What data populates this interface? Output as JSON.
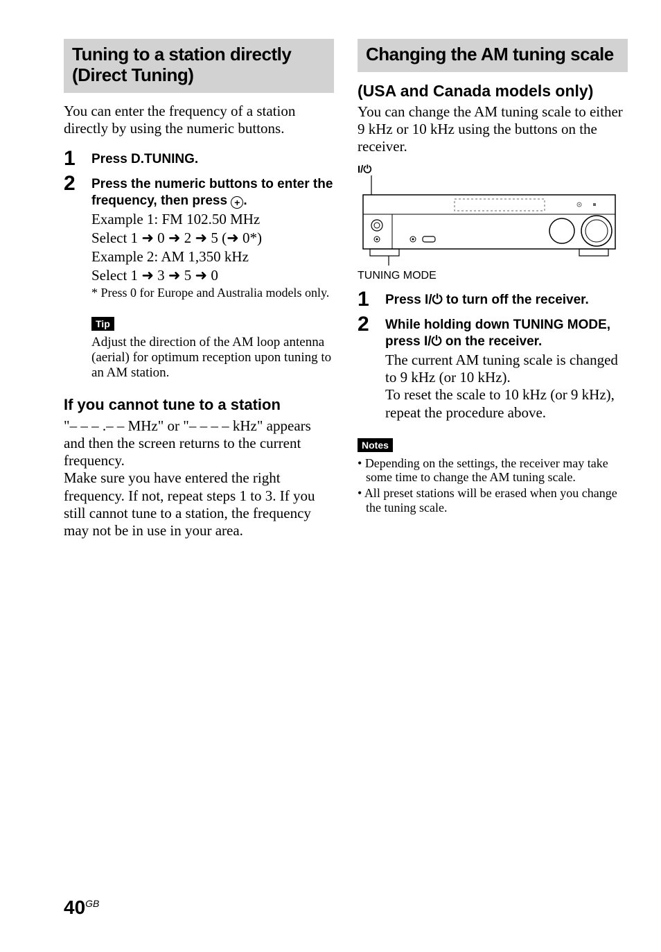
{
  "left": {
    "header": "Tuning to a station directly (Direct Tuning)",
    "intro": "You can enter the frequency of a station directly by using the numeric buttons.",
    "steps": [
      {
        "num": "1",
        "bold": "Press D.TUNING."
      },
      {
        "num": "2",
        "bold_pre": "Press the numeric buttons to enter the frequency, then press ",
        "bold_post": ".",
        "enter_icon": "+",
        "ex1": "Example 1: FM 102.50 MHz",
        "sel1_pre": "Select 1 ",
        "sel1_mid": " 0 ",
        "sel1_mid2": " 2 ",
        "sel1_mid3": " 5 (",
        "sel1_end": " 0*)",
        "ex2": "Example 2: AM 1,350 kHz",
        "sel2_pre": "Select 1 ",
        "sel2_mid": " 3 ",
        "sel2_mid2": " 5 ",
        "sel2_end": " 0",
        "footnote": "* Press 0 for Europe and Australia models only."
      }
    ],
    "tip_label": "Tip",
    "tip_body": "Adjust the direction of the AM loop antenna (aerial) for optimum reception upon tuning to an AM station.",
    "sub_heading": "If you cannot tune to a station",
    "sub_body": "\"– – – .– – MHz\" or \"– – – – kHz\" appears and then the screen returns to the current frequency.\nMake sure you have entered the right frequency. If not, repeat steps 1 to 3. If you still cannot tune to a station, the frequency may not be in use in your area."
  },
  "right": {
    "header": "Changing the AM tuning scale",
    "usa_heading": "(USA and Canada models only)",
    "intro": "You can change the AM tuning scale to either 9 kHz or 10 kHz using the buttons on the receiver.",
    "label_top_pre": "I/",
    "power_icon": "⏻",
    "label_bottom": "TUNING MODE",
    "steps": [
      {
        "num": "1",
        "bold_pre": "Press I/",
        "bold_post": " to turn off the receiver."
      },
      {
        "num": "2",
        "bold_pre": "While holding down TUNING MODE, press I/",
        "bold_post": " on the receiver.",
        "body": "The current AM tuning scale is changed to 9 kHz (or 10 kHz).\nTo reset the scale to 10 kHz (or 9 kHz), repeat the procedure above."
      }
    ],
    "notes_label": "Notes",
    "notes": [
      "Depending on the settings, the receiver may take some time to change the AM tuning scale.",
      "All preset stations will be erased when you change the tuning scale."
    ]
  },
  "page_number": "40",
  "page_suffix": "GB",
  "arrow_glyph": "➜"
}
